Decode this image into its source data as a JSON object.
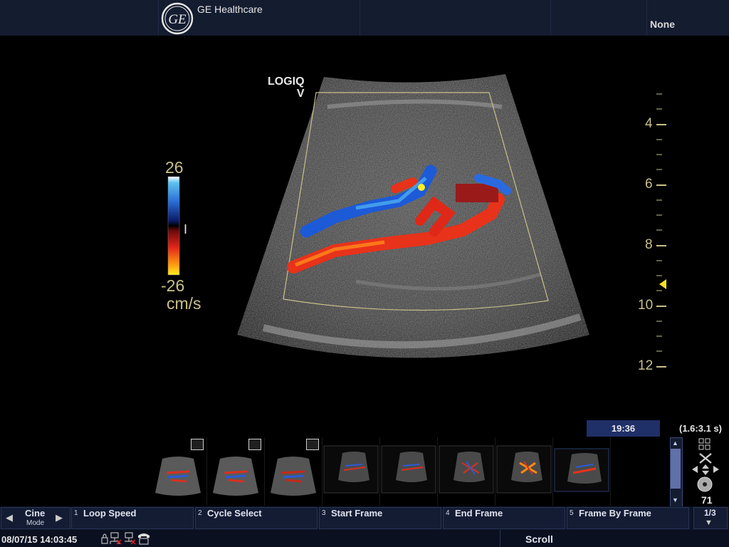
{
  "header": {
    "logo_text": "GE",
    "company": "GE Healthcare",
    "preset": "None"
  },
  "image": {
    "device_label_line1": "LOGIQ",
    "device_label_line2": "V",
    "color_scale": {
      "max": "26",
      "min": "-26",
      "unit": "cm/s",
      "zero_marker": "I"
    },
    "depth_scale": [
      "4",
      "6",
      "8",
      "10",
      "12"
    ]
  },
  "status": {
    "time": "19:36",
    "range": "(1.6:3.1 s)",
    "frame_count": "71",
    "page": "1/3",
    "datetime": "08/07/15 14:03:45",
    "scroll_label": "Scroll"
  },
  "softkeys": {
    "cine": {
      "label": "Cine",
      "sub": "Mode"
    },
    "items": [
      {
        "num": "1",
        "label": "Loop Speed"
      },
      {
        "num": "2",
        "label": "Cycle Select"
      },
      {
        "num": "3",
        "label": "Start Frame"
      },
      {
        "num": "4",
        "label": "End Frame"
      },
      {
        "num": "5",
        "label": "Frame By Frame"
      }
    ]
  },
  "icons": {
    "logo": "ge-logo-icon",
    "filmstrip": "film-icon",
    "grid": "grid-icon",
    "tools": "tools-icon",
    "move": "move-arrows-icon",
    "disc": "disc-icon",
    "network": "network-icon",
    "phone": "phone-icon",
    "lock": "lock-icon"
  },
  "colors": {
    "header_bg": "#141c30",
    "accent_blue": "#1f3068",
    "scale_text": "#c9c08a",
    "doppler_red": "#e8321a",
    "doppler_blue": "#1d5ad8"
  }
}
